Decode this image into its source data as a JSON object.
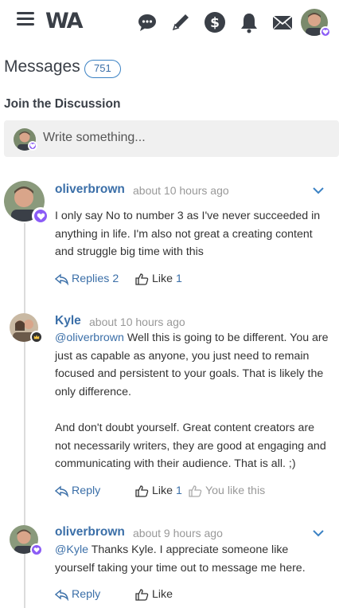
{
  "header": {
    "logo_text": "WA",
    "icons": [
      "menu-icon",
      "chat-bubbles-icon",
      "pencil-icon",
      "dollar-icon",
      "bell-icon",
      "mail-icon",
      "user-avatar"
    ]
  },
  "page": {
    "title": "Messages",
    "count": "751",
    "join_heading": "Join the Discussion",
    "composer_placeholder": "Write something..."
  },
  "comments": [
    {
      "author": "oliverbrown",
      "time": "about 10 hours ago",
      "body_lines": [
        "I only say No to number 3 as I've never succeeded in anything in life. I'm also not great a creating content and struggle big time with this"
      ],
      "replies_label": "Replies",
      "replies_count": "2",
      "like_label": "Like",
      "like_count": "1"
    },
    {
      "author": "Kyle",
      "time": "about 10 hours ago",
      "mention": "@oliverbrown",
      "para1": " Well this is going to be different. You are just as capable as anyone, you just need to remain focused and persistent to your goals. That is likely the only difference.",
      "para2": "And don't doubt yourself. Great content creators are not necessarily writers, they are good at engaging and communicating with their audience. That is all. ;)",
      "reply_label": "Reply",
      "like_label": "Like",
      "like_count": "1",
      "you_like": "You like this"
    },
    {
      "author": "oliverbrown",
      "time": "about 9 hours ago",
      "mention": "@Kyle",
      "body": " Thanks Kyle. I appreciate someone like yourself taking your time out to message me here.",
      "reply_label": "Reply",
      "like_label": "Like"
    }
  ],
  "colors": {
    "accent": "#3b6fa8",
    "badge_purple": "#8b5cf6",
    "muted": "#999999"
  }
}
